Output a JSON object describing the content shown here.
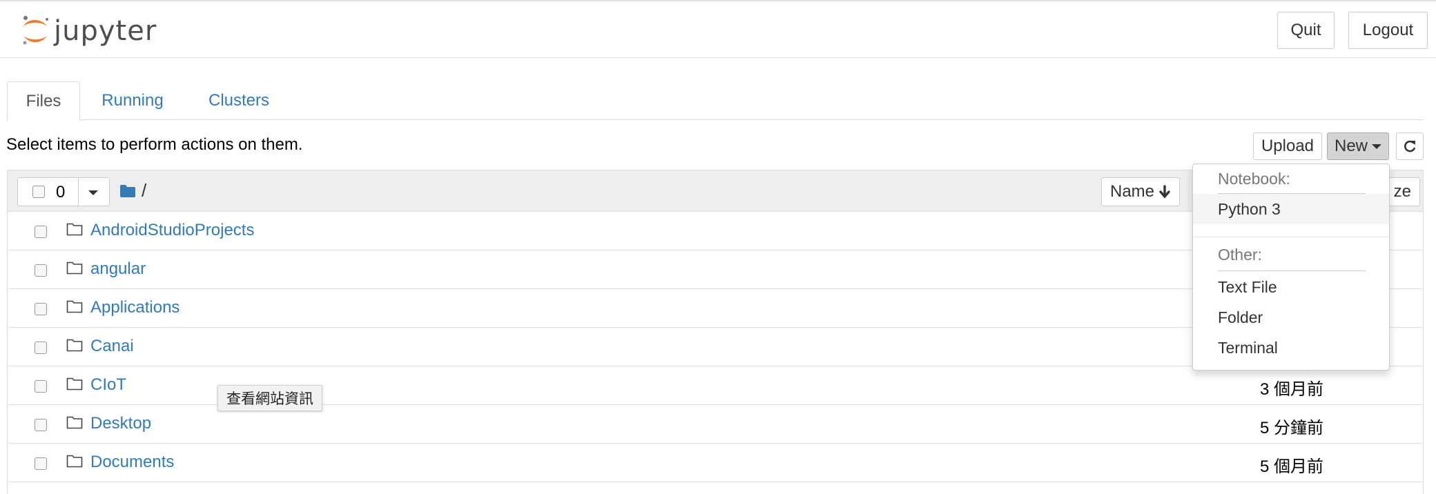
{
  "header": {
    "logo_text": "jupyter",
    "quit_label": "Quit",
    "logout_label": "Logout"
  },
  "tabs": [
    {
      "label": "Files",
      "active": true
    },
    {
      "label": "Running",
      "active": false
    },
    {
      "label": "Clusters",
      "active": false
    }
  ],
  "toolbar": {
    "hint": "Select items to perform actions on them.",
    "upload_label": "Upload",
    "new_label": "New"
  },
  "list_header": {
    "selected_count": "0",
    "path": "/",
    "sort_name_label": "Name",
    "sort_size_partial": "ze"
  },
  "files": [
    {
      "name": "AndroidStudioProjects",
      "modified": ""
    },
    {
      "name": "angular",
      "modified": ""
    },
    {
      "name": "Applications",
      "modified": ""
    },
    {
      "name": "Canai",
      "modified": ""
    },
    {
      "name": "CIoT",
      "modified": "3 個月前"
    },
    {
      "name": "Desktop",
      "modified": "5 分鐘前"
    },
    {
      "name": "Documents",
      "modified": "5 個月前"
    }
  ],
  "new_menu": {
    "notebook_header": "Notebook:",
    "python_label": "Python 3",
    "other_header": "Other:",
    "text_file_label": "Text File",
    "folder_label": "Folder",
    "terminal_label": "Terminal"
  },
  "tooltip": "查看網站資訊",
  "colors": {
    "link": "#337ab7",
    "logo_orange": "#f37726",
    "new_button_bg": "#d4d4d4"
  }
}
